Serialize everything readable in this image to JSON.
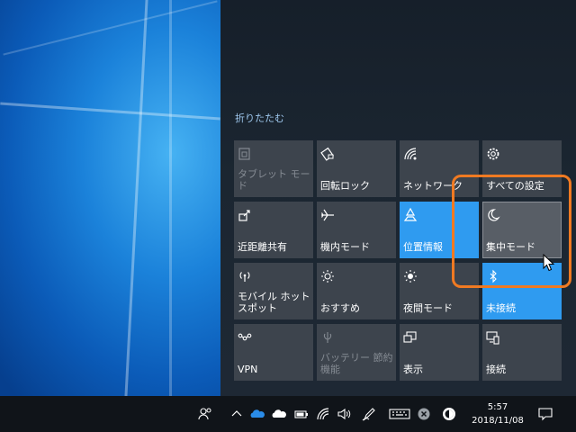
{
  "action_center": {
    "collapse_label": "折りたたむ",
    "tiles": [
      {
        "label": "タブレット モード",
        "icon": "tablet-mode-icon",
        "state": "disabled"
      },
      {
        "label": "回転ロック",
        "icon": "rotation-lock-icon",
        "state": "off"
      },
      {
        "label": "ネットワーク",
        "icon": "network-icon",
        "state": "off"
      },
      {
        "label": "すべての設定",
        "icon": "gear-icon",
        "state": "off"
      },
      {
        "label": "近距離共有",
        "icon": "nearby-share-icon",
        "state": "off"
      },
      {
        "label": "機内モード",
        "icon": "airplane-icon",
        "state": "off"
      },
      {
        "label": "位置情報",
        "icon": "location-icon",
        "state": "on"
      },
      {
        "label": "集中モード",
        "icon": "moon-icon",
        "state": "hover"
      },
      {
        "label": "モバイル ホットスポット",
        "icon": "hotspot-icon",
        "state": "off"
      },
      {
        "label": "おすすめ",
        "icon": "brightness-icon",
        "state": "off"
      },
      {
        "label": "夜間モード",
        "icon": "night-light-icon",
        "state": "off"
      },
      {
        "label": "未接続",
        "icon": "bluetooth-icon",
        "state": "on"
      },
      {
        "label": "VPN",
        "icon": "vpn-icon",
        "state": "off"
      },
      {
        "label": "バッテリー 節約機能",
        "icon": "battery-saver-icon",
        "state": "disabled"
      },
      {
        "label": "表示",
        "icon": "project-icon",
        "state": "off"
      },
      {
        "label": "接続",
        "icon": "connect-icon",
        "state": "off"
      }
    ]
  },
  "taskbar": {
    "time": "5:57",
    "date": "2018/11/08",
    "tray_icons": [
      "people-icon",
      "chevron-up-icon",
      "onedrive-icon",
      "cloud-icon",
      "battery-icon",
      "wifi-icon",
      "volume-icon",
      "pen-icon",
      "keyboard-icon",
      "close-circle-icon",
      "app-icon"
    ],
    "notification_icon": "notification-icon"
  },
  "colors": {
    "tile": "#3d444d",
    "tile_on": "#2f9bf0",
    "highlight": "#f07a22",
    "taskbar": "#101419"
  }
}
